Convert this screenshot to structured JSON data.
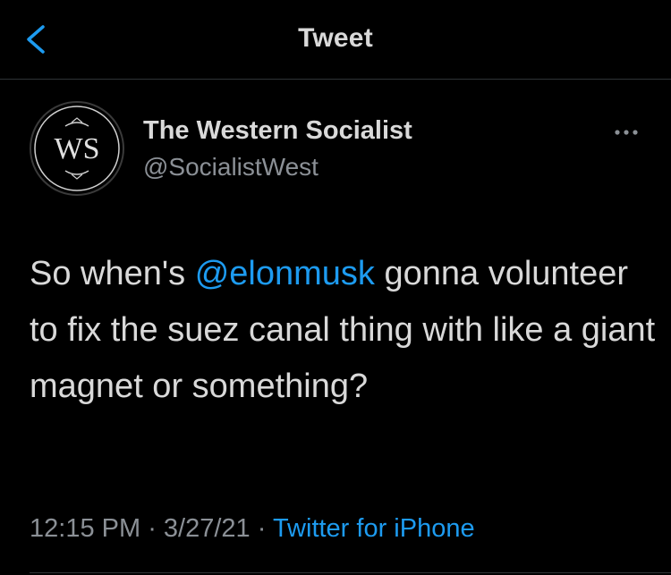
{
  "header": {
    "title": "Tweet",
    "back_icon": "chevron-left-icon"
  },
  "author": {
    "name": "The Western Socialist",
    "handle": "@SocialistWest",
    "avatar_monogram": "WS"
  },
  "tweet": {
    "text_before": "So when's ",
    "mention": "@elonmusk",
    "text_after": " gonna volunteer to fix the suez canal thing with like a giant magnet or something?"
  },
  "meta": {
    "time": "12:15 PM",
    "separator1": " · ",
    "date": "3/27/21",
    "separator2": " · ",
    "source": "Twitter for iPhone"
  },
  "colors": {
    "background": "#000000",
    "text": "#d9d9d9",
    "secondary": "#8b9096",
    "accent": "#1d9bf0",
    "divider": "#2f3336"
  },
  "icons": {
    "more": "more-horizontal-icon"
  }
}
